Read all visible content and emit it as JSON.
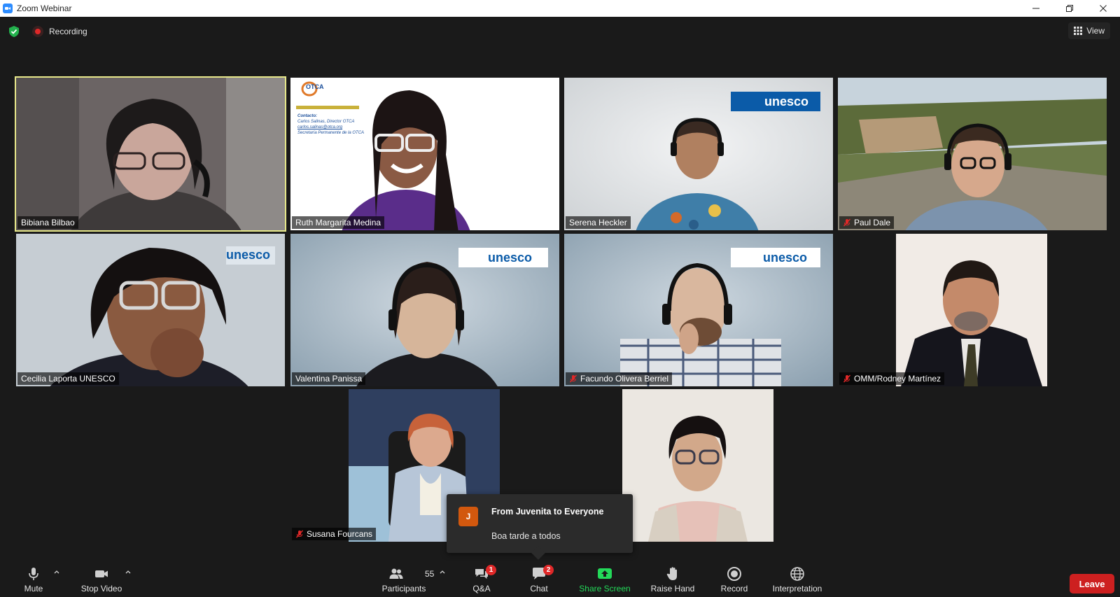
{
  "window": {
    "title": "Zoom Webinar"
  },
  "top": {
    "recording_label": "Recording",
    "view_label": "View"
  },
  "participants": [
    {
      "name": "Bibiana Bilbao",
      "muted": false,
      "speaking": true
    },
    {
      "name": "Ruth Margarita Medina",
      "muted": false,
      "speaking": false
    },
    {
      "name": "Serena Heckler",
      "muted": false,
      "speaking": false
    },
    {
      "name": "Paul Dale",
      "muted": true,
      "speaking": false
    },
    {
      "name": "Cecilia Laporta UNESCO",
      "muted": false,
      "speaking": false
    },
    {
      "name": "Valentina Panissa",
      "muted": false,
      "speaking": false
    },
    {
      "name": "Facundo Olivera Berriel",
      "muted": true,
      "speaking": false
    },
    {
      "name": "OMM/Rodney Martínez",
      "muted": true,
      "speaking": false
    },
    {
      "name": "Susana Fourcans",
      "muted": true,
      "speaking": false
    },
    {
      "name": "",
      "muted": false,
      "speaking": false
    }
  ],
  "backgrounds": {
    "unesco_text": "unesco",
    "otca_logo_text": "OTCA",
    "otca_contact_title": "Contacto:",
    "otca_contact_lines": [
      "Carlos Salinas, Director OTCA",
      "carlos.salinas@otca.org",
      "Secretaría Permanente de la OTCA"
    ]
  },
  "chat_popup": {
    "avatar_letter": "J",
    "from": "From Juvenita to Everyone",
    "message": "Boa tarde a todos"
  },
  "toolbar": {
    "mute": "Mute",
    "stop_video": "Stop Video",
    "participants": "Participants",
    "participants_count": "55",
    "qa": "Q&A",
    "qa_badge": "1",
    "chat": "Chat",
    "chat_badge": "2",
    "share_screen": "Share Screen",
    "raise_hand": "Raise Hand",
    "record": "Record",
    "interpretation": "Interpretation",
    "leave": "Leave"
  },
  "colors": {
    "speaking_border": "#e7e88a",
    "share_green": "#23d959",
    "leave_red": "#cd2020",
    "badge_red": "#e02828",
    "unesco_blue": "#0b5ba8"
  }
}
